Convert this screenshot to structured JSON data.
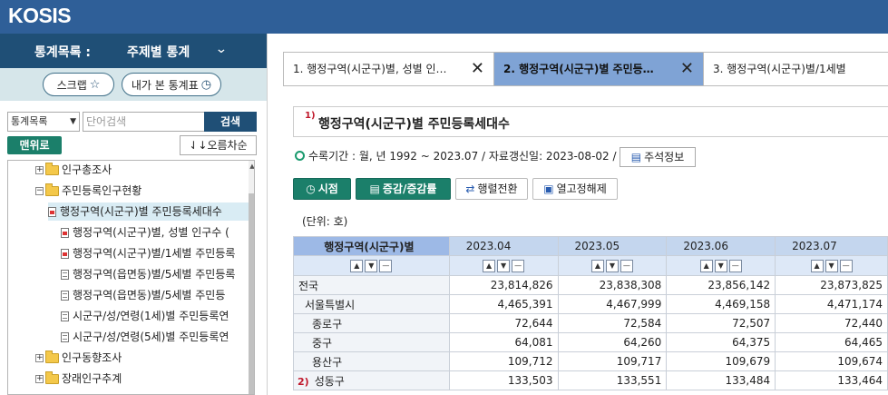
{
  "app": {
    "logo": "KOSIS"
  },
  "left_panel": {
    "header_label": "통계목록 :",
    "header_value": "주제별 통계",
    "scrap_button": "스크랩",
    "my_stats_button": "내가 본 통계표",
    "search_select": "통계목록",
    "search_placeholder": "단어검색",
    "search_button": "검색",
    "menu_button": "맨위로",
    "sort_button": "오름차순",
    "tree": [
      {
        "label": "인구총조사"
      },
      {
        "label": "주민등록인구현황"
      },
      {
        "label": "행정구역(시군구)별 주민등록세대수"
      },
      {
        "label": "행정구역(시군구)별, 성별 인구수 ("
      },
      {
        "label": "행정구역(시군구)별/1세별 주민등록"
      },
      {
        "label": "행정구역(읍면동)별/5세별 주민등록"
      },
      {
        "label": "행정구역(읍면동)별/5세별 주민등"
      },
      {
        "label": "시군구/성/연령(1세)별 주민등록연"
      },
      {
        "label": "시군구/성/연령(5세)별 주민등록연"
      },
      {
        "label": "인구동향조사"
      },
      {
        "label": "장래인구추계"
      }
    ]
  },
  "tabs": [
    {
      "label": "1. 행정구역(시군구)별, 성별 인…"
    },
    {
      "label": "2. 행정구역(시군구)별 주민등…"
    },
    {
      "label": "3. 행정구역(시군구)별/1세별"
    }
  ],
  "content": {
    "title_mark": "1)",
    "title": "행정구역(시군구)별 주민등록세대수",
    "period_text": "수록기간 : 월, 년 1992 ~ 2023.07 / 자료갱신일: 2023-08-02 /",
    "note_button": "주석정보",
    "btn_time": "시점",
    "btn_change": "증감/증감률",
    "btn_pivot": "행렬전환",
    "btn_unfix": "열고정해제",
    "unit": "(단위: 호)"
  },
  "table": {
    "row_header": "행정구역(시군구)별",
    "columns": [
      "2023.04",
      "2023.05",
      "2023.06",
      "2023.07"
    ],
    "rows": [
      {
        "name": "전국",
        "values": [
          "23,814,826",
          "23,838,308",
          "23,856,142",
          "23,873,825"
        ]
      },
      {
        "name": "서울특별시",
        "values": [
          "4,465,391",
          "4,467,999",
          "4,469,158",
          "4,471,174"
        ]
      },
      {
        "name": "종로구",
        "values": [
          "72,644",
          "72,584",
          "72,507",
          "72,440"
        ]
      },
      {
        "name": "중구",
        "values": [
          "64,081",
          "64,260",
          "64,375",
          "64,465"
        ]
      },
      {
        "name": "용산구",
        "values": [
          "109,712",
          "109,717",
          "109,679",
          "109,674"
        ]
      },
      {
        "name": "성동구",
        "mark": "2)",
        "values": [
          "133,503",
          "133,551",
          "133,484",
          "133,464"
        ]
      }
    ]
  }
}
